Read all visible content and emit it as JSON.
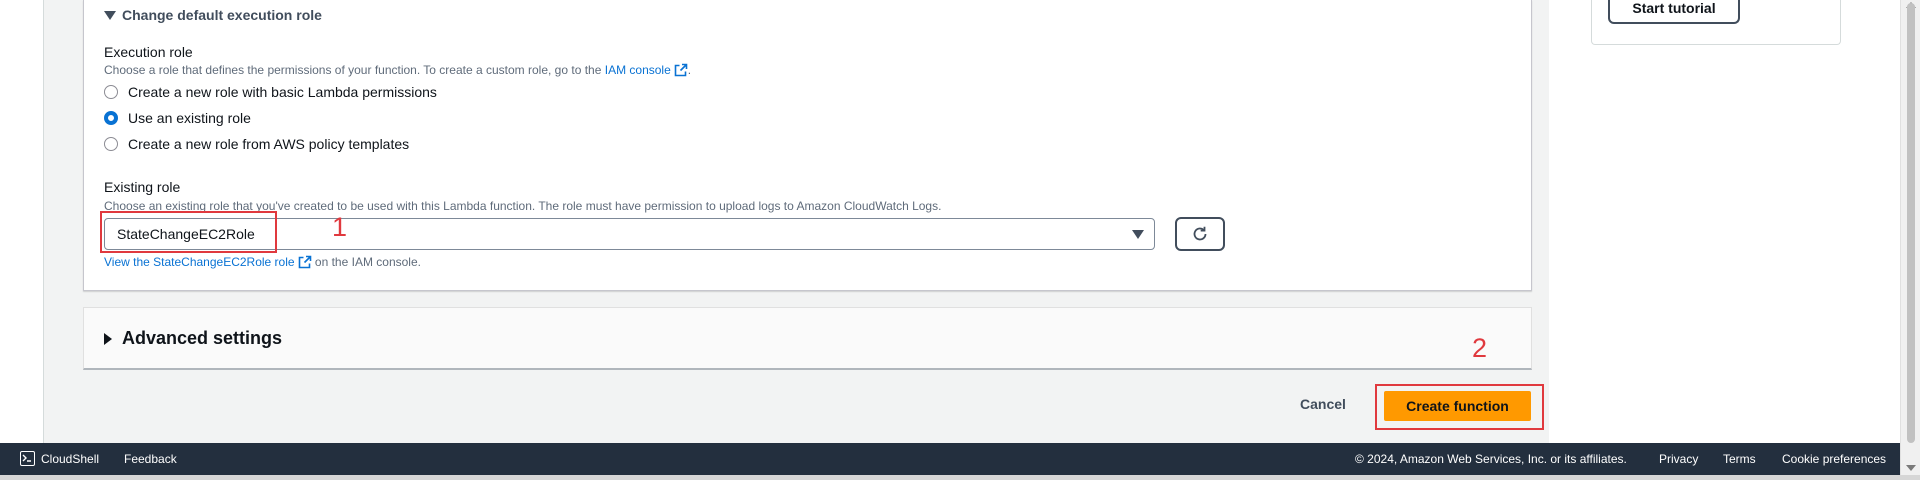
{
  "tutorial": {
    "button_label": "Start tutorial"
  },
  "permissions": {
    "section_title": "Change default execution role",
    "execution_role": {
      "label": "Execution role",
      "description": "Choose a role that defines the permissions of your function. To create a custom role, go to the ",
      "iam_console_link": "IAM console",
      "description_end": ".",
      "options": [
        {
          "label": "Create a new role with basic Lambda permissions",
          "selected": false
        },
        {
          "label": "Use an existing role",
          "selected": true
        },
        {
          "label": "Create a new role from AWS policy templates",
          "selected": false
        }
      ]
    },
    "existing_role": {
      "label": "Existing role",
      "description": "Choose an existing role that you've created to be used with this Lambda function. The role must have permission to upload logs to Amazon CloudWatch Logs.",
      "selected_value": "StateChangeEC2Role",
      "view_link": "View the StateChangeEC2Role role",
      "view_suffix": " on the IAM console."
    }
  },
  "advanced": {
    "title": "Advanced settings"
  },
  "actions": {
    "cancel_label": "Cancel",
    "create_label": "Create function"
  },
  "annotations": {
    "step1": "1",
    "step2": "2"
  },
  "footer": {
    "cloudshell": "CloudShell",
    "feedback": "Feedback",
    "copyright": "© 2024, Amazon Web Services, Inc. or its affiliates.",
    "privacy": "Privacy",
    "terms": "Terms",
    "cookies": "Cookie preferences"
  },
  "colors": {
    "accent": "#0972d3",
    "primary_button": "#ff9900",
    "highlight": "#e0393e",
    "footer_bg": "#232f3e"
  }
}
